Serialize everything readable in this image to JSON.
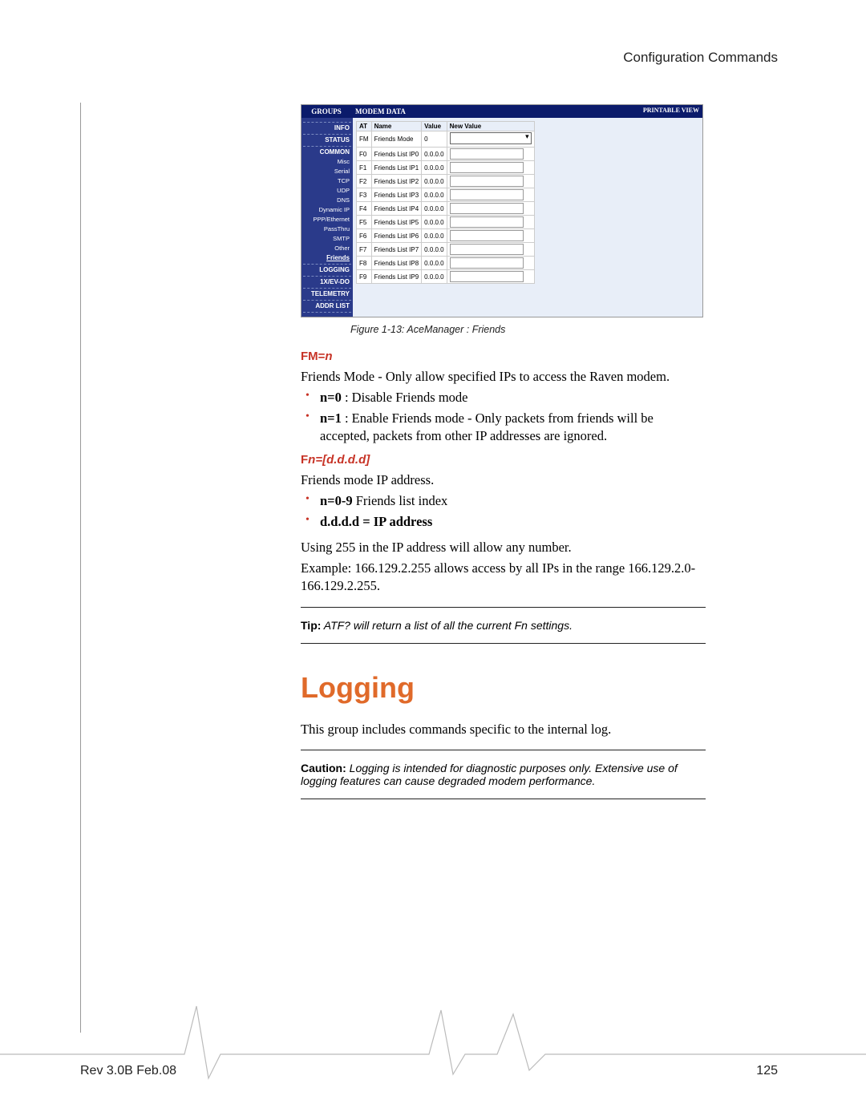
{
  "header": {
    "section_title": "Configuration Commands"
  },
  "ace": {
    "groups_label": "GROUPS",
    "modem_data_label": "MODEM DATA",
    "printable_view": "PRINTABLE VIEW",
    "side_items": [
      {
        "label": "INFO",
        "cls": "link"
      },
      {
        "label": "STATUS",
        "cls": "link"
      },
      {
        "label": "COMMON",
        "cls": "link"
      },
      {
        "label": "Misc",
        "cls": "sub"
      },
      {
        "label": "Serial",
        "cls": "sub"
      },
      {
        "label": "TCP",
        "cls": "sub"
      },
      {
        "label": "UDP",
        "cls": "sub"
      },
      {
        "label": "DNS",
        "cls": "sub"
      },
      {
        "label": "Dynamic IP",
        "cls": "sub"
      },
      {
        "label": "PPP/Ethernet",
        "cls": "sub"
      },
      {
        "label": "PassThru",
        "cls": "sub"
      },
      {
        "label": "SMTP",
        "cls": "sub"
      },
      {
        "label": "Other",
        "cls": "sub"
      },
      {
        "label": "Friends",
        "cls": "sel"
      },
      {
        "label": "LOGGING",
        "cls": "link"
      },
      {
        "label": "1X/EV-DO",
        "cls": "link"
      },
      {
        "label": "TELEMETRY",
        "cls": "link"
      },
      {
        "label": "ADDR LIST",
        "cls": "link"
      }
    ],
    "separators_after": [
      0,
      1,
      13,
      14,
      15,
      16,
      17
    ],
    "separators_before_first": true,
    "columns": [
      "AT",
      "Name",
      "Value",
      "New Value"
    ],
    "rows": [
      {
        "at": "FM",
        "name": "Friends Mode",
        "value": "0",
        "dropdown": true
      },
      {
        "at": "F0",
        "name": "Friends List IP0",
        "value": "0.0.0.0"
      },
      {
        "at": "F1",
        "name": "Friends List IP1",
        "value": "0.0.0.0"
      },
      {
        "at": "F2",
        "name": "Friends List IP2",
        "value": "0.0.0.0"
      },
      {
        "at": "F3",
        "name": "Friends List IP3",
        "value": "0.0.0.0"
      },
      {
        "at": "F4",
        "name": "Friends List IP4",
        "value": "0.0.0.0"
      },
      {
        "at": "F5",
        "name": "Friends List IP5",
        "value": "0.0.0.0"
      },
      {
        "at": "F6",
        "name": "Friends List IP6",
        "value": "0.0.0.0"
      },
      {
        "at": "F7",
        "name": "Friends List IP7",
        "value": "0.0.0.0"
      },
      {
        "at": "F8",
        "name": "Friends List IP8",
        "value": "0.0.0.0"
      },
      {
        "at": "F9",
        "name": "Friends List IP9",
        "value": "0.0.0.0"
      }
    ]
  },
  "figure_caption": "Figure 1-13: AceManager : Friends",
  "cmd_fm": {
    "head_prefix": "FM=",
    "head_param": "n",
    "desc": "Friends Mode - Only allow specified IPs to access the Raven modem.",
    "bullets": [
      {
        "bold": "n=0",
        "rest": " : Disable Friends mode"
      },
      {
        "bold": "n=1",
        "rest": " : Enable Friends mode - Only packets from friends will be accepted, packets from other IP addresses are ignored."
      }
    ]
  },
  "cmd_fn": {
    "head_prefix": "F",
    "head_param": "n=[d.d.d.d]",
    "desc": "Friends mode IP address.",
    "bullets": [
      {
        "bold": "n=0-9",
        "rest": " Friends list index"
      },
      {
        "bold": "d.d.d.d = IP address",
        "rest": ""
      }
    ],
    "para1": "Using 255 in the IP address will allow any number.",
    "para2": "Example: 166.129.2.255 allows access by all IPs in the range 166.129.2.0-166.129.2.255."
  },
  "tip": {
    "label": "Tip:",
    "text": " ATF? will return a list of all the current Fn settings."
  },
  "logging": {
    "heading": "Logging",
    "intro": "This group includes commands specific to the internal log."
  },
  "caution": {
    "label": "Caution:",
    "text": " Logging is intended for diagnostic purposes only. Extensive use of logging features can cause degraded modem performance."
  },
  "footer": {
    "rev": "Rev 3.0B Feb.08",
    "page": "125"
  }
}
